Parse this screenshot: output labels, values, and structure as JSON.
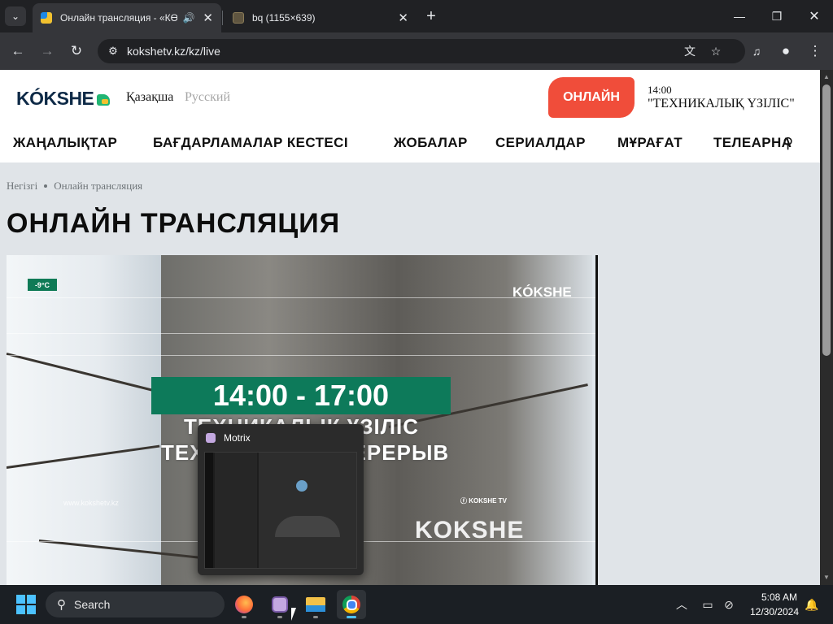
{
  "browser": {
    "tabs": [
      {
        "title": "Онлайн трансляция - «КӨ",
        "active": true
      },
      {
        "title": "bq (1155×639)",
        "active": false
      }
    ],
    "url": "kokshetv.kz/kz/live"
  },
  "site": {
    "logo": "KÓKSHE",
    "languages": [
      "Қазақша",
      "Русский"
    ],
    "online_button": "ОНЛАЙН",
    "now_playing": {
      "time": "14:00",
      "title": "\"ТЕХНИКАЛЫҚ ҮЗІЛІС\""
    },
    "nav": [
      "ЖАҢАЛЫҚТАР",
      "БАҒДАРЛАМАЛАР КЕСТЕСІ",
      "ЖОБАЛАР",
      "СЕРИАЛДАР",
      "МҰРАҒАТ",
      "ТЕЛЕАРНА"
    ],
    "breadcrumb": [
      "Негізгі",
      "Онлайн трансляция"
    ],
    "page_title": "ОНЛАЙН ТРАНСЛЯЦИЯ"
  },
  "video": {
    "temperature": "-9°C",
    "channel_logo": "KÓKSHE",
    "time_range": "14:00 - 17:00",
    "notice_kz": "ТЕХНИКАЛЫҚ ҮЗІЛІС",
    "notice_ru": "ТЕХНИЧЕСКИЙ ПЕРЕРЫВ",
    "watermark": "www.kokshetv.kz",
    "facebook_badge": "KOKSHE TV",
    "footer_logo": "KOKSHE"
  },
  "taskbar_preview": {
    "title": "Motrix"
  },
  "taskbar": {
    "search_placeholder": "Search",
    "apps": [
      "firefox-icon",
      "motrix-icon",
      "file-explorer-icon",
      "chrome-icon"
    ],
    "time": "5:08 AM",
    "date": "12/30/2024"
  },
  "colors": {
    "accent_online": "#f04d3a",
    "brand_green": "#0d7a5a",
    "taskbar_accent": "#4cc2ff"
  }
}
